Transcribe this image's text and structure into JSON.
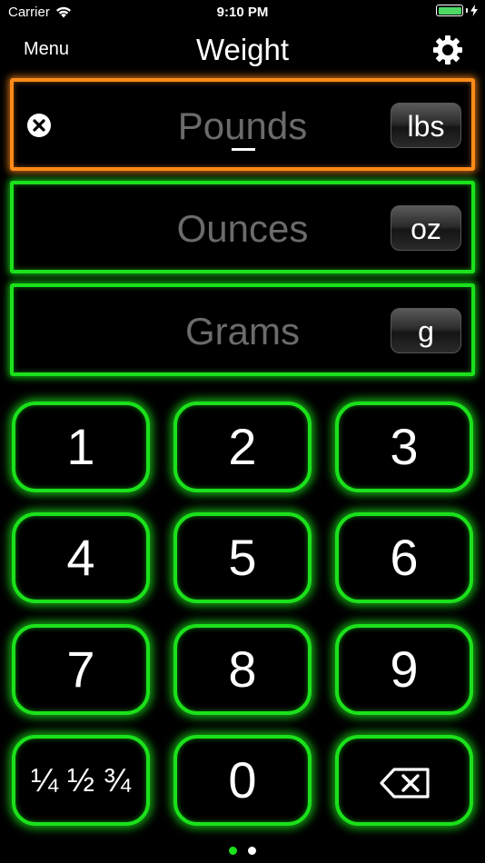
{
  "status": {
    "carrier": "Carrier",
    "time": "9:10 PM"
  },
  "nav": {
    "menu_label": "Menu",
    "title": "Weight"
  },
  "fields": {
    "pounds": {
      "placeholder": "Pounds",
      "unit": "lbs"
    },
    "ounces": {
      "placeholder": "Ounces",
      "unit": "oz"
    },
    "grams": {
      "placeholder": "Grams",
      "unit": "g"
    }
  },
  "keypad": {
    "k1": "1",
    "k2": "2",
    "k3": "3",
    "k4": "4",
    "k5": "5",
    "k6": "6",
    "k7": "7",
    "k8": "8",
    "k9": "9",
    "fractions": "¼ ½ ¾",
    "k0": "0"
  },
  "colors": {
    "active_border": "#ff8a1a",
    "idle_border": "#1be11b",
    "page_dot_active": "#1be11b",
    "page_dot_inactive": "#ffffff"
  },
  "pager": {
    "current": 1,
    "total": 2
  }
}
